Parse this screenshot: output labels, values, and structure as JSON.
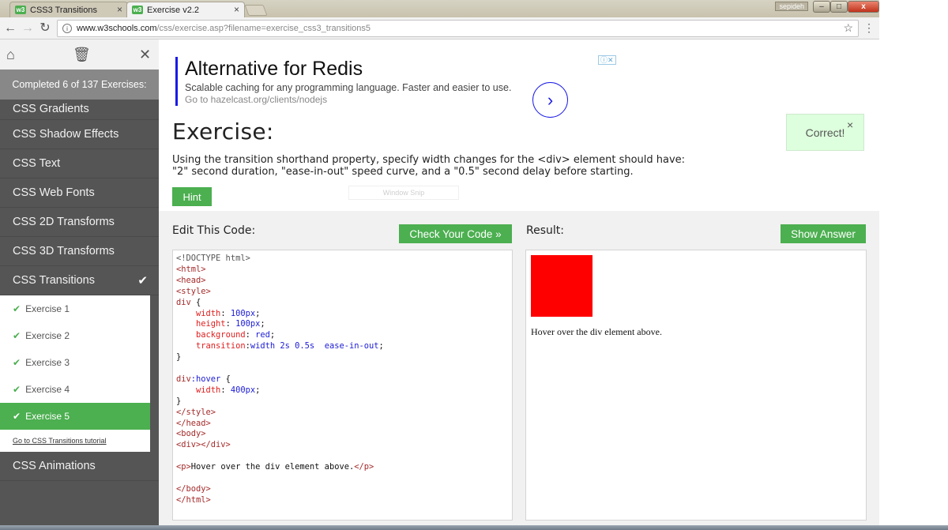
{
  "browser": {
    "tabs": [
      {
        "label": "CSS3 Transitions",
        "favicon": "w3"
      },
      {
        "label": "Exercise v2.2",
        "favicon": "w3"
      }
    ],
    "user_chip": "sepideh",
    "window_buttons": {
      "minimize": "–",
      "maximize": "□",
      "close": "x"
    },
    "url_host": "www.w3schools.com",
    "url_path": "/css/exercise.asp?filename=exercise_css3_transitions5"
  },
  "sidebar": {
    "progress_text": "Completed 6 of 137 Exercises:",
    "sections_before": [
      "CSS Gradients",
      "CSS Shadow Effects",
      "CSS Text",
      "CSS Web Fonts",
      "CSS 2D Transforms",
      "CSS 3D Transforms"
    ],
    "current_section": "CSS Transitions",
    "exercises": [
      "Exercise 1",
      "Exercise 2",
      "Exercise 3",
      "Exercise 4",
      "Exercise 5"
    ],
    "active_exercise": "Exercise 5",
    "tutorial_link": "Go to CSS Transitions tutorial",
    "sections_after": [
      "CSS Animations"
    ]
  },
  "ad": {
    "title": "Alternative for Redis",
    "description": "Scalable caching for any programming language. Faster and easier to use.",
    "url": "Go to hazelcast.org/clients/nodejs",
    "choices": "ⓘ✕"
  },
  "exercise": {
    "heading": "Exercise:",
    "instructions_line1": "Using the transition shorthand property, specify width changes for the <div> element should have:",
    "instructions_line2": "\"2\" second duration, \"ease-in-out\" speed curve, and a \"0.5\" second delay before starting.",
    "hint_label": "Hint",
    "snip_label": "Window Snip",
    "correct_label": "Correct!",
    "correct_close": "×"
  },
  "editor": {
    "label": "Edit This Code:",
    "check_button": "Check Your Code »",
    "lines": [
      [
        {
          "t": "<!DOCTYPE html>",
          "c": "doc"
        }
      ],
      [
        {
          "t": "<html>",
          "c": "tag"
        }
      ],
      [
        {
          "t": "<head>",
          "c": "tag"
        }
      ],
      [
        {
          "t": "<style>",
          "c": "tag"
        }
      ],
      [
        {
          "t": "div",
          "c": "sel"
        },
        {
          "t": " {",
          "c": "txt"
        }
      ],
      [
        {
          "t": "    ",
          "c": "txt"
        },
        {
          "t": "width",
          "c": "prop"
        },
        {
          "t": ": ",
          "c": "txt"
        },
        {
          "t": "100px",
          "c": "val"
        },
        {
          "t": ";",
          "c": "txt"
        }
      ],
      [
        {
          "t": "    ",
          "c": "txt"
        },
        {
          "t": "height",
          "c": "prop"
        },
        {
          "t": ": ",
          "c": "txt"
        },
        {
          "t": "100px",
          "c": "val"
        },
        {
          "t": ";",
          "c": "txt"
        }
      ],
      [
        {
          "t": "    ",
          "c": "txt"
        },
        {
          "t": "background",
          "c": "prop"
        },
        {
          "t": ": ",
          "c": "txt"
        },
        {
          "t": "red",
          "c": "val"
        },
        {
          "t": ";",
          "c": "txt"
        }
      ],
      [
        {
          "t": "    ",
          "c": "txt"
        },
        {
          "t": "transition",
          "c": "prop"
        },
        {
          "t": ":",
          "c": "txt"
        },
        {
          "t": "width 2s 0.5s  ease-in-out",
          "c": "val"
        },
        {
          "t": ";",
          "c": "txt"
        }
      ],
      [
        {
          "t": "}",
          "c": "txt"
        }
      ],
      [
        {
          "t": "",
          "c": "txt"
        }
      ],
      [
        {
          "t": "div",
          "c": "sel"
        },
        {
          "t": ":hover",
          "c": "val"
        },
        {
          "t": " {",
          "c": "txt"
        }
      ],
      [
        {
          "t": "    ",
          "c": "txt"
        },
        {
          "t": "width",
          "c": "prop"
        },
        {
          "t": ": ",
          "c": "txt"
        },
        {
          "t": "400px",
          "c": "val"
        },
        {
          "t": ";",
          "c": "txt"
        }
      ],
      [
        {
          "t": "}",
          "c": "txt"
        }
      ],
      [
        {
          "t": "</style>",
          "c": "tag"
        }
      ],
      [
        {
          "t": "</head>",
          "c": "tag"
        }
      ],
      [
        {
          "t": "<body>",
          "c": "tag"
        }
      ],
      [
        {
          "t": "<div></div>",
          "c": "tag"
        }
      ],
      [
        {
          "t": "",
          "c": "txt"
        }
      ],
      [
        {
          "t": "<p>",
          "c": "tag"
        },
        {
          "t": "Hover over the div element above.",
          "c": "txt"
        },
        {
          "t": "</p>",
          "c": "tag"
        }
      ],
      [
        {
          "t": "",
          "c": "txt"
        }
      ],
      [
        {
          "t": "</body>",
          "c": "tag"
        }
      ],
      [
        {
          "t": "</html>",
          "c": "tag"
        }
      ]
    ]
  },
  "result": {
    "label": "Result:",
    "show_answer_button": "Show Answer",
    "text": "Hover over the div element above."
  },
  "colors": {
    "accent_green": "#4caf50",
    "sidebar_bg": "#555555",
    "progress_bg": "#888888",
    "correct_bg": "#ddffdd",
    "result_div": "#ff0000"
  }
}
